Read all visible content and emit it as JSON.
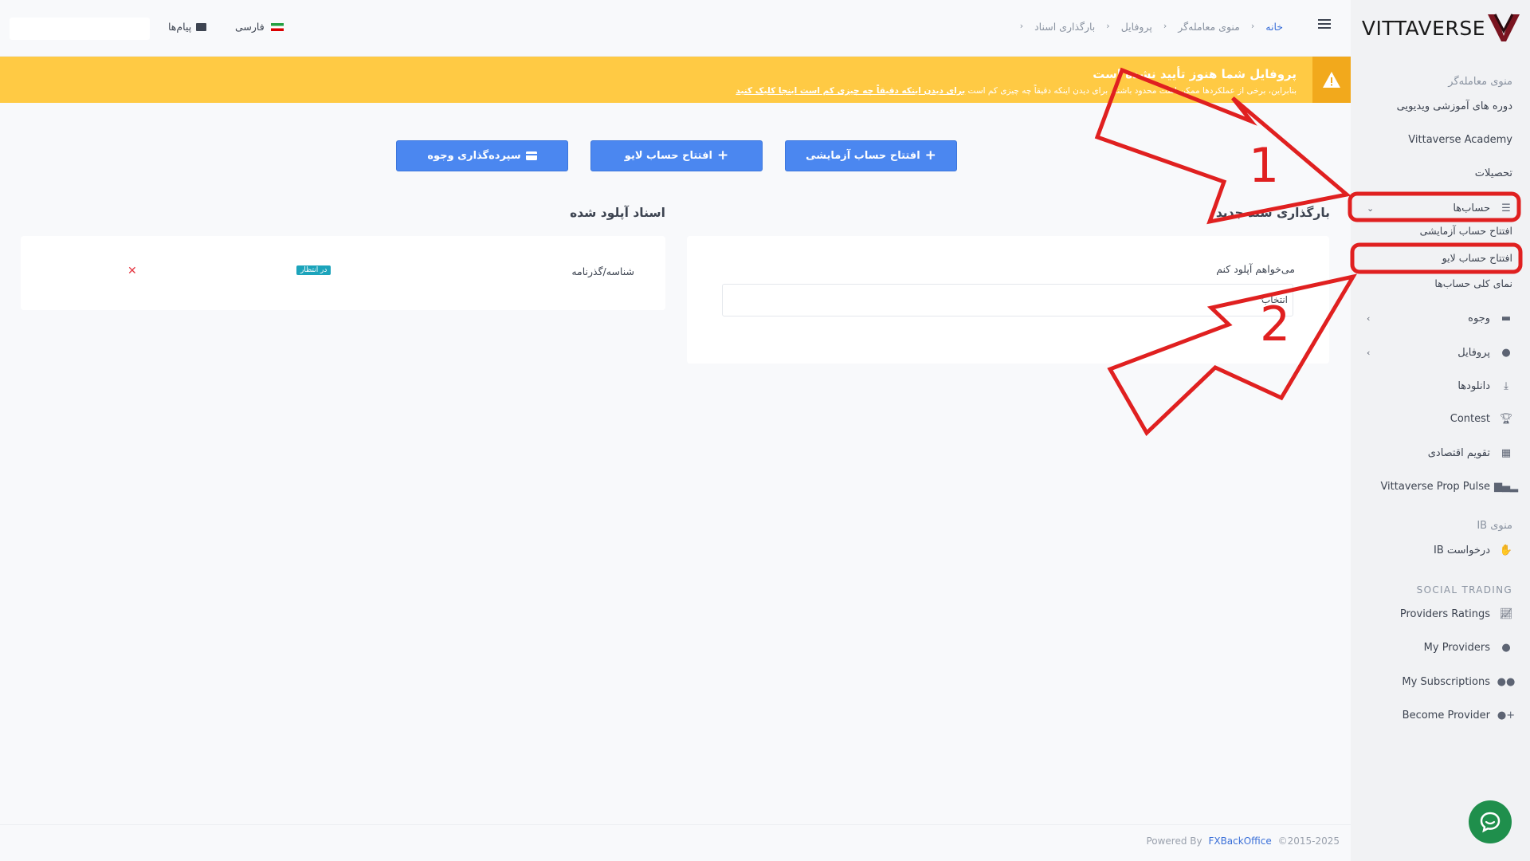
{
  "app": {
    "brand": "VITTAVERSE"
  },
  "topbar": {
    "breadcrumb": [
      "خانه",
      "منوی معامله‌گر",
      "پروفایل",
      "بارگذاری اسناد"
    ],
    "separator": "‹",
    "language": "فارسی",
    "messages": "پیام‌ها"
  },
  "banner": {
    "title": "پروفایل شما هنوز تأیید نشده است",
    "desc_prefix": "بنابراین، برخی از عملکردها ممکن است محدود باشند. برای دیدن اینکه دقیقاً چه چیزی کم است",
    "desc_link": "برای دیدن اینکه دقیقاً چه چیزی کم است اینجا کلیک کنید"
  },
  "actions": {
    "demo_account": "افتتاح حساب آزمایشی",
    "live_account": "افتتاح حساب لایو",
    "deposit": "سپرده‌گذاری وجوه"
  },
  "upload": {
    "heading": "بارگذاری سند جدید",
    "field_label": "می‌خواهم آپلود کنم",
    "select_value": "انتخاب"
  },
  "uploaded": {
    "heading": "اسناد آپلود شده",
    "docs": [
      {
        "name": "شناسه/گذرنامه",
        "status": "در انتظار"
      }
    ]
  },
  "sidebar": {
    "section_trader": "منوی معامله‌گر",
    "items": [
      {
        "label": "دوره های آموزشی ویدیویی"
      },
      {
        "label": "Vittaverse Academy"
      },
      {
        "label": "تحصیلات"
      },
      {
        "label": "حساب‌ها",
        "icon": "list-icon"
      },
      {
        "label": "افتتاح حساب آزمایشی"
      },
      {
        "label": "افتتاح حساب لایو"
      },
      {
        "label": "نمای کلی حساب‌ها"
      },
      {
        "label": "وجوه",
        "icon": "wallet-icon"
      },
      {
        "label": "پروفایل",
        "icon": "user-icon"
      },
      {
        "label": "دانلودها",
        "icon": "download-icon"
      },
      {
        "label": "Contest",
        "icon": "trophy-icon"
      },
      {
        "label": "تقویم اقتصادی",
        "icon": "calendar-icon"
      },
      {
        "label": "Vittaverse Prop Pulse",
        "icon": "signal-icon"
      }
    ],
    "section_ib": "منوی IB",
    "ib_items": [
      {
        "label": "درخواست IB",
        "icon": "handshake-icon"
      }
    ],
    "section_social": "SOCIAL TRADING",
    "social_items": [
      {
        "label": "Providers Ratings",
        "icon": "chart-line-icon"
      },
      {
        "label": "My Providers",
        "icon": "user-tie-icon"
      },
      {
        "label": "My Subscriptions",
        "icon": "users-icon"
      },
      {
        "label": "Become Provider",
        "icon": "user-plus-icon"
      }
    ]
  },
  "annotations": {
    "labels": [
      "1",
      "2"
    ],
    "color": "#e02020"
  },
  "footer": {
    "powered": "Powered By",
    "company": "FXBackOffice",
    "copyright": "©2015-2025"
  },
  "colors": {
    "primary": "#4b87f0",
    "warning": "#ffca44",
    "badge": "#1ca4bb",
    "danger": "#e53944",
    "chat": "#1f8f4c"
  }
}
